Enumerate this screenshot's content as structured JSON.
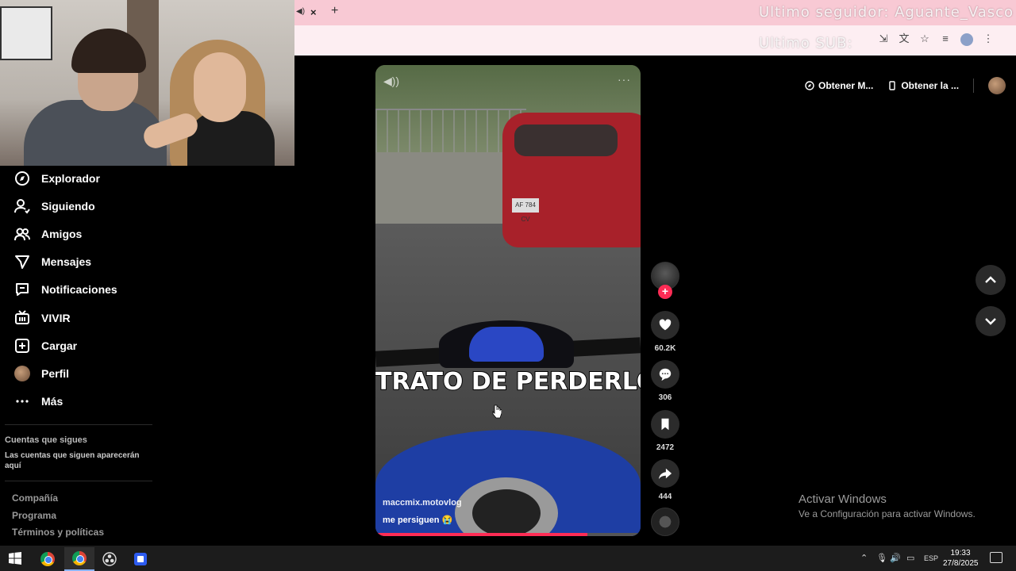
{
  "browser": {
    "tab_close": "×",
    "new_tab": "+",
    "overlay_follower": "Ultimo seguidor: Aguante_Vasco",
    "overlay_sub": "Ultimo SUB:"
  },
  "sidebar": {
    "items": [
      {
        "label": "Explorador",
        "icon": "compass-icon"
      },
      {
        "label": "Siguiendo",
        "icon": "user-follow-icon"
      },
      {
        "label": "Amigos",
        "icon": "friends-icon"
      },
      {
        "label": "Mensajes",
        "icon": "send-icon"
      },
      {
        "label": "Notificaciones",
        "icon": "message-square-icon"
      },
      {
        "label": "VIVIR",
        "icon": "tv-icon"
      },
      {
        "label": "Cargar",
        "icon": "plus-square-icon"
      },
      {
        "label": "Perfil",
        "icon": "avatar"
      },
      {
        "label": "Más",
        "icon": "more-dots-icon"
      }
    ],
    "following_title": "Cuentas que sigues",
    "following_desc": "Las cuentas que siguen aparecerán aquí",
    "footer": [
      "Compañía",
      "Programa",
      "Términos y políticas"
    ]
  },
  "video": {
    "caption_overlay": "TRATO DE PERDERLO",
    "username": "maccmix.motovlog",
    "description": "me persiguen 😭",
    "plate": "AF 784 CV",
    "progress": 0.8
  },
  "actions": {
    "likes": "60.2K",
    "comments": "306",
    "saves": "2472",
    "shares": "444",
    "follow": "+"
  },
  "top_pills": {
    "get_app_1": "Obtener M...",
    "get_app_2": "Obtener la ..."
  },
  "windows": {
    "activate_title": "Activar Windows",
    "activate_sub": "Ve a Configuración para activar Windows."
  },
  "taskbar": {
    "lang": "ESP",
    "time": "19:33",
    "date": "27/8/2025"
  },
  "colors": {
    "accent": "#fe2c55",
    "tab_bg": "#f8c9d4",
    "taskbar_bg": "#1c1c1c"
  }
}
